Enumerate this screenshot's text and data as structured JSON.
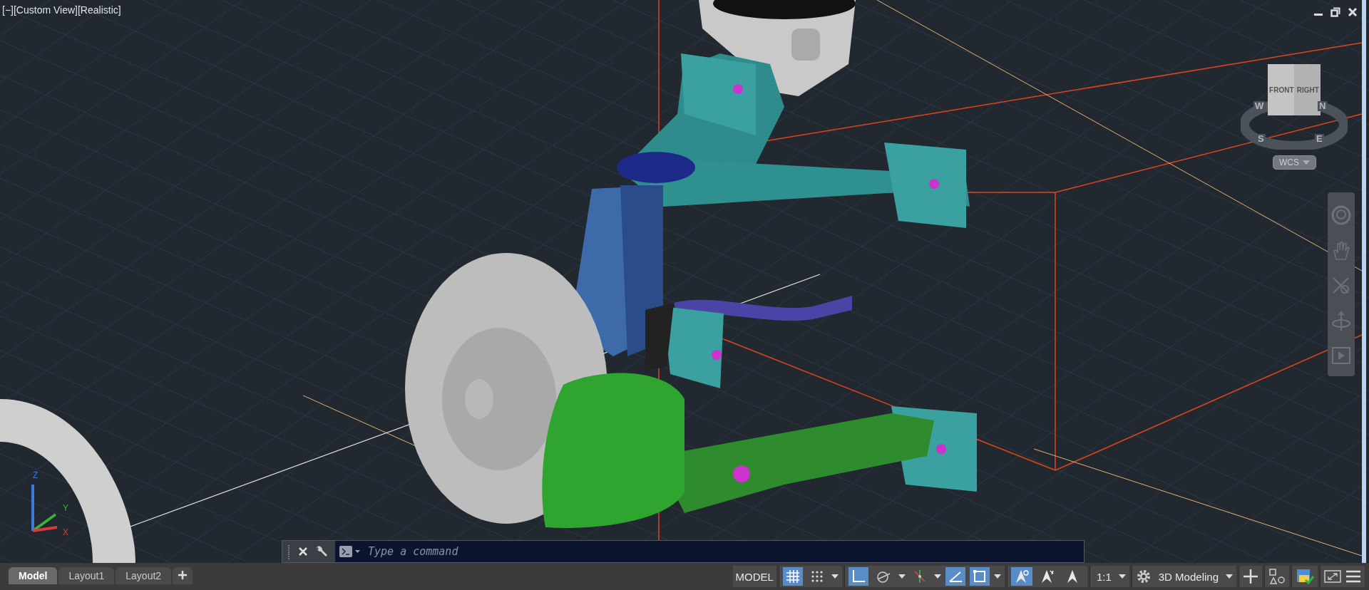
{
  "viewport": {
    "label": "[−][Custom View][Realistic]"
  },
  "viewcube": {
    "faces": [
      "FRONT",
      "RIGHT"
    ],
    "compass": [
      "W",
      "N",
      "S",
      "E"
    ],
    "ucs_menu": "WCS"
  },
  "ucs_icon": {
    "axes": [
      "Z",
      "Y",
      "X"
    ]
  },
  "command_line": {
    "placeholder": "Type a command"
  },
  "layout_tabs": [
    {
      "label": "Model",
      "selected": true
    },
    {
      "label": "Layout1",
      "selected": false
    },
    {
      "label": "Layout2",
      "selected": false
    }
  ],
  "status_bar": {
    "model_label": "MODEL",
    "toggle_groups": [
      [
        {
          "kind": "grid",
          "on": true,
          "dropdown": false
        },
        {
          "kind": "snap",
          "on": false,
          "dropdown": true
        }
      ],
      [
        {
          "kind": "ortho",
          "on": true,
          "dropdown": false
        },
        {
          "kind": "polar",
          "on": false,
          "dropdown": true
        },
        {
          "kind": "isodraft",
          "on": false,
          "dropdown": true
        },
        {
          "kind": "dynucs",
          "on": true,
          "dropdown": false
        },
        {
          "kind": "selcycle",
          "on": true,
          "dropdown": true
        }
      ],
      [
        {
          "kind": "annovis",
          "on": true,
          "dropdown": false
        },
        {
          "kind": "autoscale",
          "on": false,
          "dropdown": false
        },
        {
          "kind": "annoscale",
          "on": false,
          "dropdown": false
        }
      ]
    ],
    "scale": "1:1",
    "workspace": "3D Modeling"
  }
}
